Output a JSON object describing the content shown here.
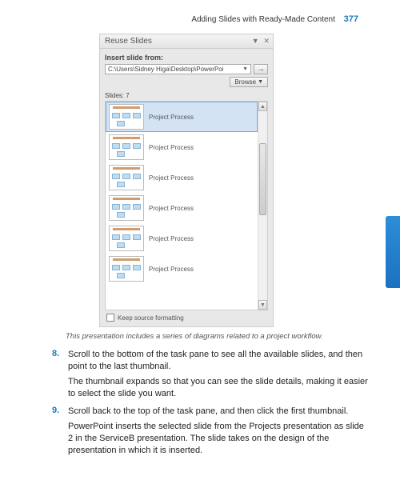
{
  "header": {
    "chapter_title": "Adding Slides with Ready-Made Content",
    "page_number": "377"
  },
  "pane": {
    "title": "Reuse Slides",
    "insert_label": "Insert slide from:",
    "path_value": "C:\\Users\\Sidney Higa\\Desktop\\PowerPoi",
    "browse_label": "Browse",
    "slides_header": "Slides: 7",
    "slides": [
      {
        "label": "Project Process",
        "selected": true
      },
      {
        "label": "Project Process",
        "selected": false
      },
      {
        "label": "Project Process",
        "selected": false
      },
      {
        "label": "Project Process",
        "selected": false
      },
      {
        "label": "Project Process",
        "selected": false
      },
      {
        "label": "Project Process",
        "selected": false
      }
    ],
    "keep_formatting": "Keep source formatting"
  },
  "caption": "This presentation includes a series of diagrams related to a project workflow.",
  "steps": {
    "s8_num": "8.",
    "s8_text": "Scroll to the bottom of the task pane to see all the available slides, and then point to the last thumbnail.",
    "s8_para": "The thumbnail expands so that you can see the slide details, making it easier to select the slide you want.",
    "s9_num": "9.",
    "s9_text": "Scroll back to the top of the task pane, and then click the first thumbnail.",
    "s9_para": "PowerPoint inserts the selected slide from the Projects presentation as slide 2 in the ServiceB presentation. The slide takes on the design of the presentation in which it is inserted."
  }
}
